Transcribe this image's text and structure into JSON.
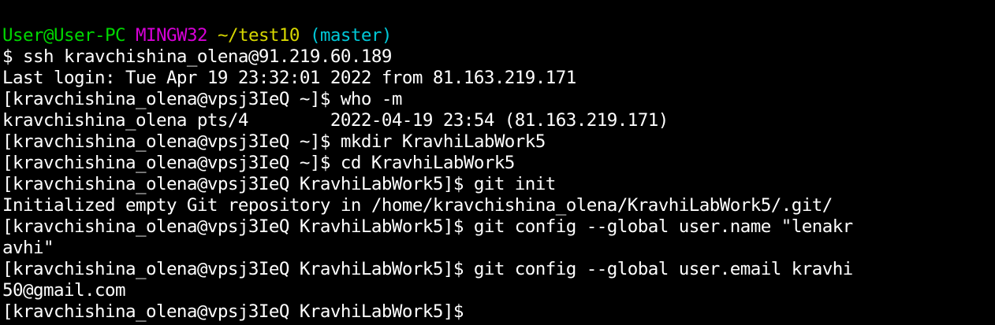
{
  "window": {
    "title": ""
  },
  "colors": {
    "background": "#000000",
    "text": "#ffffff",
    "user_host": "#00d700",
    "system": "#d700d7",
    "path": "#d7d700",
    "branch": "#00c8d7"
  },
  "prompt": {
    "user_host": "User@User-PC",
    "system": "MINGW32",
    "path": "~/test10",
    "branch": "(master)"
  },
  "lines": [
    "$ ssh kravchishina_olena@91.219.60.189",
    "Last login: Tue Apr 19 23:32:01 2022 from 81.163.219.171",
    "[kravchishina_olena@vpsj3IeQ ~]$ who -m",
    "kravchishina_olena pts/4        2022-04-19 23:54 (81.163.219.171)",
    "[kravchishina_olena@vpsj3IeQ ~]$ mkdir KravhiLabWork5",
    "[kravchishina_olena@vpsj3IeQ ~]$ cd KravhiLabWork5",
    "[kravchishina_olena@vpsj3IeQ KravhiLabWork5]$ git init",
    "Initialized empty Git repository in /home/kravchishina_olena/KravhiLabWork5/.git/",
    "[kravchishina_olena@vpsj3IeQ KravhiLabWork5]$ git config --global user.name \"lenakr",
    "avhi\"",
    "[kravchishina_olena@vpsj3IeQ KravhiLabWork5]$ git config --global user.email kravhi",
    "50@gmail.com",
    "[kravchishina_olena@vpsj3IeQ KravhiLabWork5]$"
  ]
}
